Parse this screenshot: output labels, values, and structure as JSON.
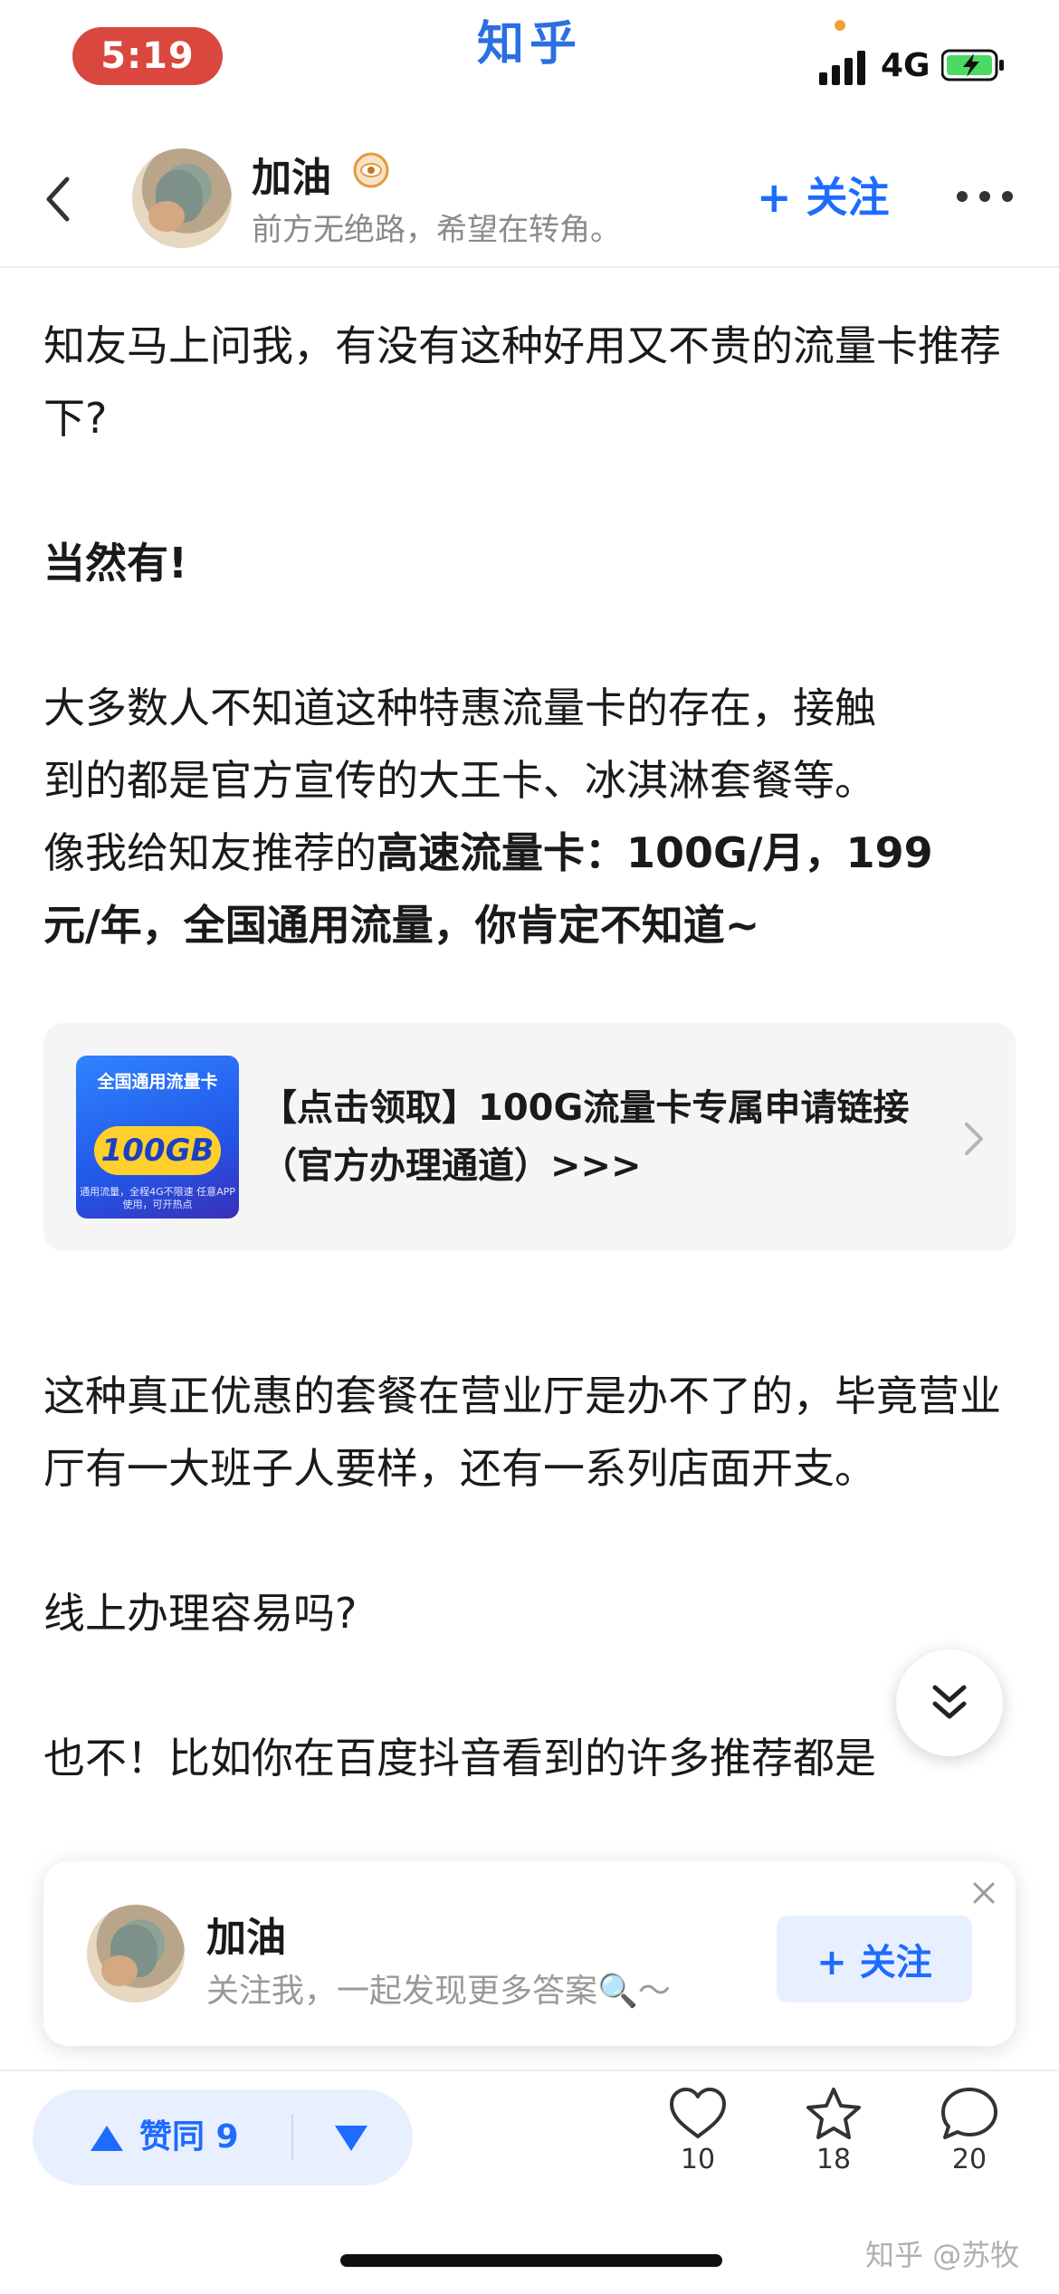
{
  "status_bar": {
    "time": "5:19",
    "app_title": "知乎",
    "network": "4G"
  },
  "header": {
    "author_name": "加油",
    "author_signature": "前方无绝路，希望在转角。",
    "follow_label": "+ 关注"
  },
  "article": {
    "p1": "知友马上问我，有没有这种好用又不贵的流量卡推荐下?",
    "p2": "当然有!",
    "p3_line1": "大多数人不知道这种特惠流量卡的存在，接触",
    "p3_line2": "到的都是官方宣传的大王卡、冰淇淋套餐等。",
    "p3_line3_prefix": "像我给知友推荐的",
    "p3_line3_bold": "高速流量卡：100G/月，199",
    "p3_line4_bold": "元/年，全国通用流量，你肯定不知道~",
    "p4": "这种真正优惠的套餐在营业厅是办不了的，毕竟营业厅有一大班子人要样，还有一系列店面开支。",
    "p5": "线上办理容易吗?",
    "p6": "也不！比如你在百度抖音看到的许多推荐都是"
  },
  "link_card": {
    "thumb_title": "全国通用流量卡",
    "thumb_amount": "100GB",
    "thumb_note": "通用流量，全程4G不限速 任意APP使用，可开热点",
    "text": "【点击领取】100G流量卡专属申请链接（官方办理通道）>>>"
  },
  "follow_card": {
    "name": "加油",
    "subtitle": "关注我，一起发现更多答案🔍～",
    "follow_label": "+ 关注"
  },
  "bottom_bar": {
    "vote_label": "赞同 9",
    "like_count": "10",
    "favorite_count": "18",
    "comment_count": "20",
    "watermark": "知乎 @苏牧"
  },
  "colors": {
    "accent": "#1e6bff",
    "time_pill": "#d9473f",
    "app_title": "#2b6fe0"
  }
}
